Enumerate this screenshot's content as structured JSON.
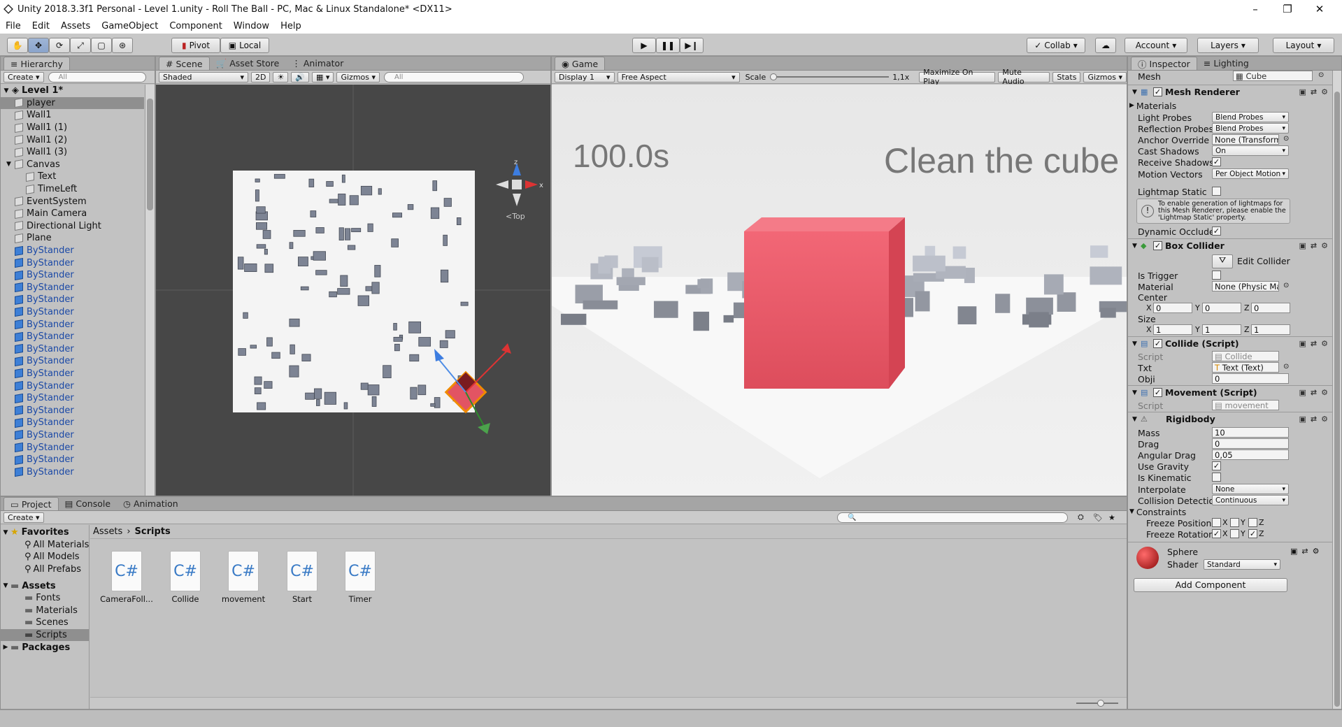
{
  "window": {
    "title": "Unity 2018.3.3f1 Personal - Level 1.unity - Roll The Ball - PC, Mac & Linux Standalone* <DX11>",
    "min": "–",
    "max": "❐",
    "close": "✕"
  },
  "menu": [
    "File",
    "Edit",
    "Assets",
    "GameObject",
    "Component",
    "Window",
    "Help"
  ],
  "toolbar": {
    "pivot": "Pivot",
    "local": "Local",
    "collab": "Collab",
    "account": "Account",
    "layers": "Layers",
    "layout": "Layout"
  },
  "hierarchy": {
    "tab": "Hierarchy",
    "create": "Create",
    "search_ph": "All",
    "scene": "Level 1*",
    "items": [
      {
        "label": "player",
        "indent": 1,
        "selected": true
      },
      {
        "label": "Wall1",
        "indent": 1
      },
      {
        "label": "Wall1 (1)",
        "indent": 1
      },
      {
        "label": "Wall1 (2)",
        "indent": 1
      },
      {
        "label": "Wall1 (3)",
        "indent": 1
      },
      {
        "label": "Canvas",
        "indent": 1,
        "expand": true
      },
      {
        "label": "Text",
        "indent": 2
      },
      {
        "label": "TimeLeft",
        "indent": 2
      },
      {
        "label": "EventSystem",
        "indent": 1
      },
      {
        "label": "Main Camera",
        "indent": 1
      },
      {
        "label": "Directional Light",
        "indent": 1
      },
      {
        "label": "Plane",
        "indent": 1
      },
      {
        "label": "ByStander",
        "indent": 1,
        "blue": true
      },
      {
        "label": "ByStander",
        "indent": 1,
        "blue": true
      },
      {
        "label": "ByStander",
        "indent": 1,
        "blue": true
      },
      {
        "label": "ByStander",
        "indent": 1,
        "blue": true
      },
      {
        "label": "ByStander",
        "indent": 1,
        "blue": true
      },
      {
        "label": "ByStander",
        "indent": 1,
        "blue": true
      },
      {
        "label": "ByStander",
        "indent": 1,
        "blue": true
      },
      {
        "label": "ByStander",
        "indent": 1,
        "blue": true
      },
      {
        "label": "ByStander",
        "indent": 1,
        "blue": true
      },
      {
        "label": "ByStander",
        "indent": 1,
        "blue": true
      },
      {
        "label": "ByStander",
        "indent": 1,
        "blue": true
      },
      {
        "label": "ByStander",
        "indent": 1,
        "blue": true
      },
      {
        "label": "ByStander",
        "indent": 1,
        "blue": true
      },
      {
        "label": "ByStander",
        "indent": 1,
        "blue": true
      },
      {
        "label": "ByStander",
        "indent": 1,
        "blue": true
      },
      {
        "label": "ByStander",
        "indent": 1,
        "blue": true
      },
      {
        "label": "ByStander",
        "indent": 1,
        "blue": true
      },
      {
        "label": "ByStander",
        "indent": 1,
        "blue": true
      },
      {
        "label": "ByStander",
        "indent": 1,
        "blue": true
      }
    ]
  },
  "scene": {
    "tabs": [
      "Scene",
      "Asset Store",
      "Animator"
    ],
    "shaded": "Shaded",
    "mode2d": "2D",
    "gizmos": "Gizmos",
    "search_ph": "All",
    "view": "Top",
    "axis_z": "z",
    "axis_x": "x"
  },
  "game": {
    "tab": "Game",
    "display": "Display 1",
    "aspect": "Free Aspect",
    "scale_label": "Scale",
    "scale_value": "1,1x",
    "maximize": "Maximize On Play",
    "mute": "Mute Audio",
    "stats": "Stats",
    "gizmos": "Gizmos",
    "timer": "100.0s",
    "message": "Clean the cube"
  },
  "inspector": {
    "tabs": [
      "Inspector",
      "Lighting"
    ],
    "mesh_label": "Mesh",
    "mesh_value": "Cube",
    "mesh_renderer": {
      "title": "Mesh Renderer",
      "materials": "Materials",
      "light_probes": "Light Probes",
      "light_probes_v": "Blend Probes",
      "reflection_probes": "Reflection Probes",
      "reflection_probes_v": "Blend Probes",
      "anchor": "Anchor Override",
      "anchor_v": "None (Transform)",
      "cast": "Cast Shadows",
      "cast_v": "On",
      "receive": "Receive Shadows",
      "motion": "Motion Vectors",
      "motion_v": "Per Object Motion",
      "lightmap": "Lightmap Static",
      "info": "To enable generation of lightmaps for this Mesh Renderer, please enable the 'Lightmap Static' property.",
      "dynamic": "Dynamic Occluded"
    },
    "box_collider": {
      "title": "Box Collider",
      "edit": "Edit Collider",
      "trigger": "Is Trigger",
      "material": "Material",
      "material_v": "None (Physic Mate",
      "center": "Center",
      "size": "Size",
      "cx": "0",
      "cy": "0",
      "cz": "0",
      "sx": "1",
      "sy": "1",
      "sz": "1",
      "X": "X",
      "Y": "Y",
      "Z": "Z"
    },
    "collide": {
      "title": "Collide (Script)",
      "script": "Script",
      "script_v": "Collide",
      "txt": "Txt",
      "txt_v": "Text (Text)",
      "obji": "Obji",
      "obji_v": "0"
    },
    "movement": {
      "title": "Movement (Script)",
      "script": "Script",
      "script_v": "movement"
    },
    "rigidbody": {
      "title": "Rigidbody",
      "mass": "Mass",
      "mass_v": "10",
      "drag": "Drag",
      "drag_v": "0",
      "angular": "Angular Drag",
      "angular_v": "0,05",
      "gravity": "Use Gravity",
      "kinematic": "Is Kinematic",
      "interpolate": "Interpolate",
      "interpolate_v": "None",
      "collision": "Collision Detection",
      "collision_v": "Continuous",
      "constraints": "Constraints",
      "freeze_pos": "Freeze Position",
      "freeze_rot": "Freeze Rotation"
    },
    "material": {
      "name": "Sphere",
      "shader": "Shader",
      "shader_v": "Standard"
    },
    "add_component": "Add Component"
  },
  "project": {
    "tabs": [
      "Project",
      "Console",
      "Animation"
    ],
    "create": "Create",
    "favorites": "Favorites",
    "fav_items": [
      "All Materials",
      "All Models",
      "All Prefabs"
    ],
    "assets": "Assets",
    "asset_items": [
      "Fonts",
      "Materials",
      "Scenes",
      "Scripts"
    ],
    "packages": "Packages",
    "breadcrumb": [
      "Assets",
      "Scripts"
    ],
    "files": [
      "CameraFoll...",
      "Collide",
      "movement",
      "Start",
      "Timer"
    ],
    "file_glyph": "C#"
  }
}
